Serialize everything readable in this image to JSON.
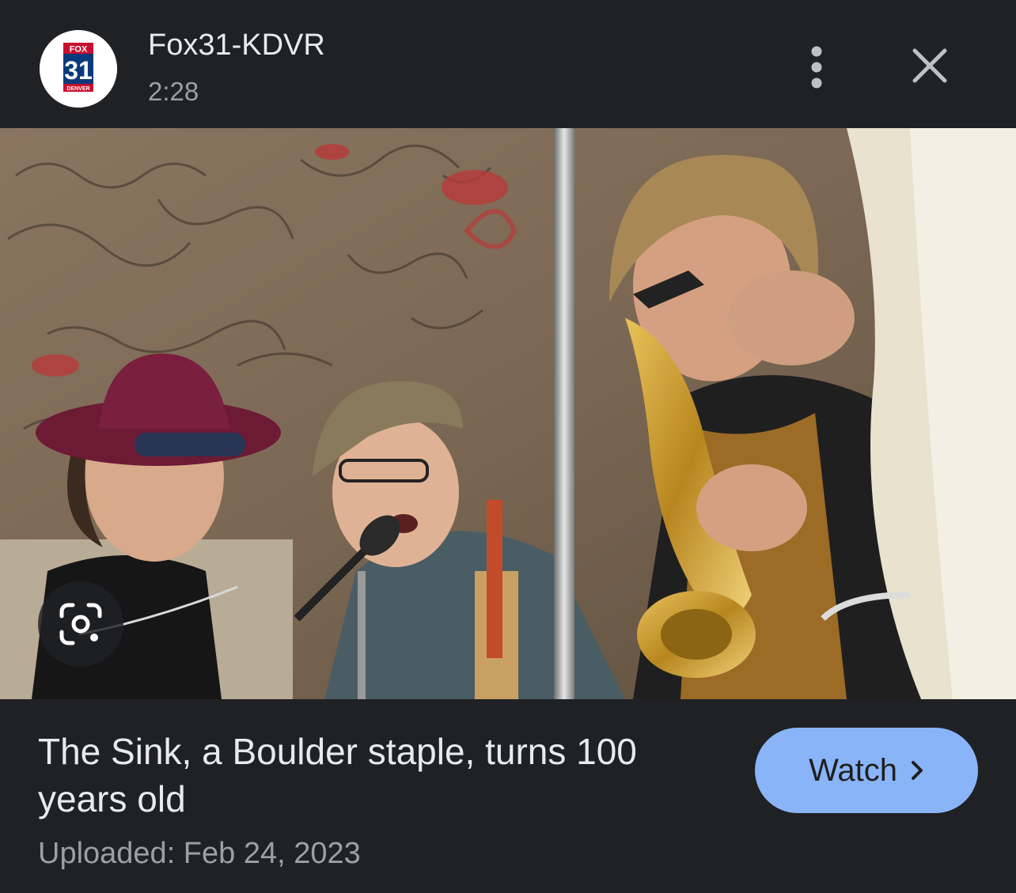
{
  "header": {
    "channel_name": "Fox31-KDVR",
    "duration": "2:28",
    "logo": {
      "top_text": "FOX",
      "number": "31",
      "bottom_text": "DENVER",
      "icon": "fox31-logo"
    },
    "more_icon": "more-vert-icon",
    "close_icon": "close-icon"
  },
  "media": {
    "lens_icon": "google-lens-icon"
  },
  "video": {
    "title": "The Sink, a Boulder staple, turns 100 years old",
    "uploaded": "Uploaded: Feb 24, 2023"
  },
  "watch_button": {
    "label": "Watch",
    "icon": "chevron-right-icon"
  },
  "colors": {
    "background": "#202124",
    "primary_text": "#e8eaed",
    "secondary_text": "#9aa0a6",
    "button_bg": "#8ab4f8",
    "logo_red": "#c8102e",
    "logo_blue": "#0a3a7a"
  }
}
